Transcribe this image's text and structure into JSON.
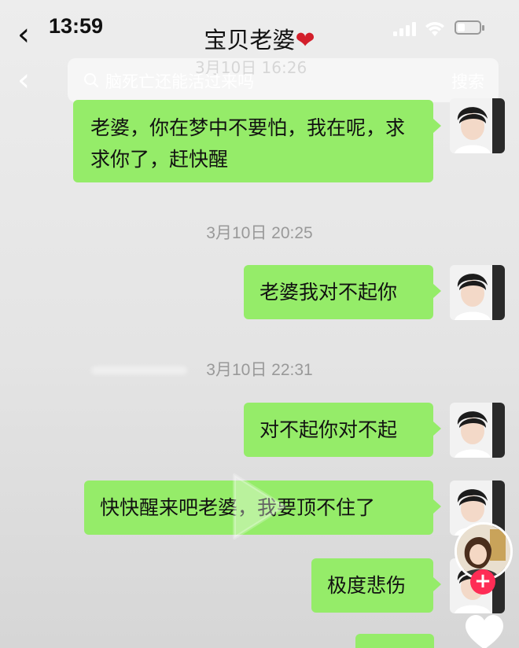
{
  "status_bar": {
    "time": "13:59"
  },
  "header": {
    "back_icon": "‹",
    "title": "宝贝老婆",
    "title_emoji": "❤"
  },
  "search": {
    "back_icon": "‹",
    "query": "脑死亡还能活过来吗",
    "ghost_timestamp": "3月10日 16:26",
    "button_label": "搜索"
  },
  "messages": [
    {
      "type": "sent",
      "text": "老婆，你在梦中不要怕，我在呢，求求你了，赶快醒"
    },
    {
      "type": "timestamp",
      "text": "3月10日 20:25"
    },
    {
      "type": "sent",
      "text": "老婆我对不起你"
    },
    {
      "type": "timestamp",
      "text": "3月10日 22:31"
    },
    {
      "type": "sent",
      "text": "对不起你对不起"
    },
    {
      "type": "sent",
      "text": "快快醒来吧老婆，我要顶不住了"
    },
    {
      "type": "sent",
      "text": "极度悲伤"
    }
  ],
  "overlay": {
    "follow_icon": "+",
    "icons": [
      "play-icon",
      "heart-like-icon",
      "streamer-avatar",
      "follow-button"
    ]
  },
  "colors": {
    "bubble": "#95ec69",
    "background": "#ededed",
    "heart": "#d31f2b",
    "follow": "#fe2c55"
  }
}
